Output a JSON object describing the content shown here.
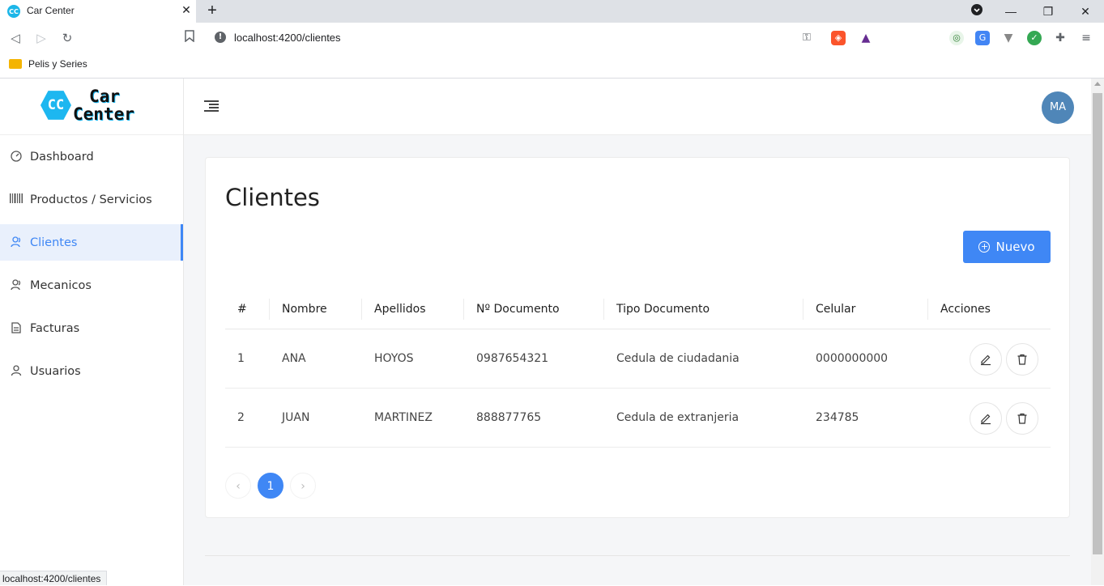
{
  "browser": {
    "tab_title": "Car Center",
    "favicon_text": "CC",
    "url": "localhost:4200/clientes",
    "bookmark_folder": "Pelis y Series",
    "status_url": "localhost:4200/clientes",
    "new_tab_symbol": "+",
    "close_symbol": "✕",
    "window_controls": {
      "minimize": "—",
      "maximize": "❐",
      "close": "✕"
    },
    "nav": {
      "back": "◁",
      "forward": "▷",
      "reload": "↻",
      "bookmark": "🔖"
    },
    "extensions": [
      "key-icon",
      "brave-shield-icon",
      "brave-rewards-icon",
      "browser-ext-icon",
      "translate-icon",
      "vue-devtools-icon",
      "check-icon",
      "puzzle-icon",
      "menu-dots-icon"
    ]
  },
  "app": {
    "logo_badge": "CC",
    "logo_line1": "Car",
    "logo_line2": "Center",
    "avatar_initials": "MA",
    "brand_color": "#3f87f5"
  },
  "sidebar": {
    "items": [
      {
        "label": "Dashboard",
        "icon": "dashboard-icon",
        "glyph": "◔",
        "active": false
      },
      {
        "label": "Productos / Servicios",
        "icon": "barcode-icon",
        "glyph": "▥",
        "active": false
      },
      {
        "label": "Clientes",
        "icon": "clients-icon",
        "glyph": "⚇",
        "active": true
      },
      {
        "label": "Mecanicos",
        "icon": "mechanics-icon",
        "glyph": "⚇",
        "active": false
      },
      {
        "label": "Facturas",
        "icon": "invoice-icon",
        "glyph": "▤",
        "active": false
      },
      {
        "label": "Usuarios",
        "icon": "user-icon",
        "glyph": "⚲",
        "active": false
      }
    ]
  },
  "main": {
    "title": "Clientes",
    "new_button_label": "Nuevo",
    "table": {
      "columns": [
        "#",
        "Nombre",
        "Apellidos",
        "Nº Documento",
        "Tipo Documento",
        "Celular",
        "Acciones"
      ],
      "rows": [
        {
          "num": "1",
          "nombre": "ANA",
          "apellidos": "HOYOS",
          "documento": "0987654321",
          "tipo": "Cedula de ciudadania",
          "celular": "0000000000"
        },
        {
          "num": "2",
          "nombre": "JUAN",
          "apellidos": "MARTINEZ",
          "documento": "888877765",
          "tipo": "Cedula de extranjeria",
          "celular": "234785"
        }
      ]
    },
    "pagination": {
      "prev": "‹",
      "current": "1",
      "next": "›"
    }
  }
}
